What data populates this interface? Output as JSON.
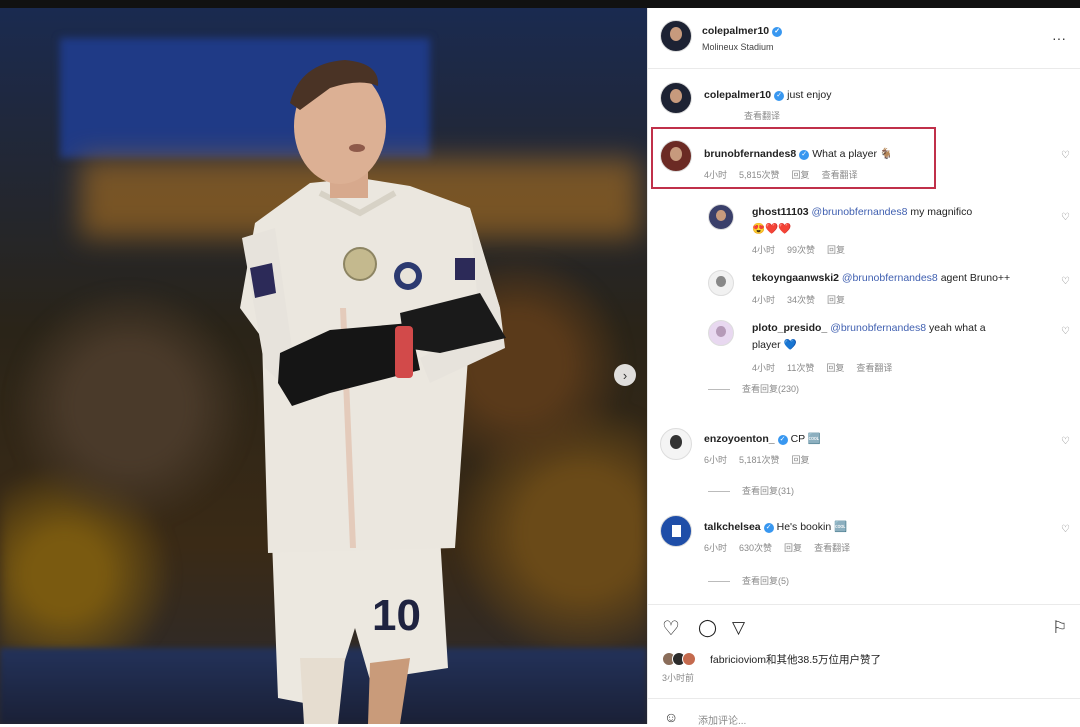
{
  "post": {
    "username": "colepalmer10",
    "location": "Molineux Stadium",
    "caption": "just enjoy",
    "caption_translate": "查看翻译",
    "shirt_number": "10"
  },
  "comments": [
    {
      "user": "brunobfernandes8",
      "text": "What a player ",
      "emoji": "🐐",
      "time": "4小时",
      "likes": "5,815次赞",
      "reply": "回复",
      "translate": "查看翻译",
      "highlighted": true
    },
    {
      "user": "ghost11103",
      "mention": "@brunobfernandes8",
      "text": " my magnifico ",
      "emoji": "😍❤️❤️",
      "time": "4小时",
      "likes": "99次赞",
      "reply": "回复"
    },
    {
      "user": "tekoyngaanwski2",
      "mention": "@brunobfernandes8",
      "text": " agent Bruno++",
      "time": "4小时",
      "likes": "34次赞",
      "reply": "回复"
    },
    {
      "user": "ploto_presido_",
      "mention": "@brunobfernandes8",
      "text": " yeah what a",
      "text2": "player ",
      "emoji": "💙",
      "time": "4小时",
      "likes": "11次赞",
      "reply": "回复",
      "translate": "查看翻译"
    },
    {
      "user": "enzoyoenton_",
      "text": "CP ",
      "emoji": "🆒",
      "time": "6小时",
      "likes": "5,181次赞",
      "reply": "回复"
    },
    {
      "user": "talkchelsea",
      "text": "He's bookin ",
      "emoji": "🆒",
      "time": "6小时",
      "likes": "630次赞",
      "reply": "回复",
      "translate": "查看翻译"
    }
  ],
  "more_replies": [
    {
      "label": "查看回复(230)"
    },
    {
      "label": "查看回复(31)"
    },
    {
      "label": "查看回复(5)"
    }
  ],
  "footer": {
    "likes_text": "fabricioviom和其他38.5万位用户赞了",
    "age": "3小时前",
    "add_comment": "添加评论..."
  },
  "icons": {
    "more": "···",
    "heart": "♡",
    "comment": "◯",
    "share": "▽",
    "save": "⚐",
    "next": "›"
  },
  "colors": {
    "highlight": "#c0304a",
    "mention": "#3f5fb0",
    "verified": "#3897f0"
  }
}
